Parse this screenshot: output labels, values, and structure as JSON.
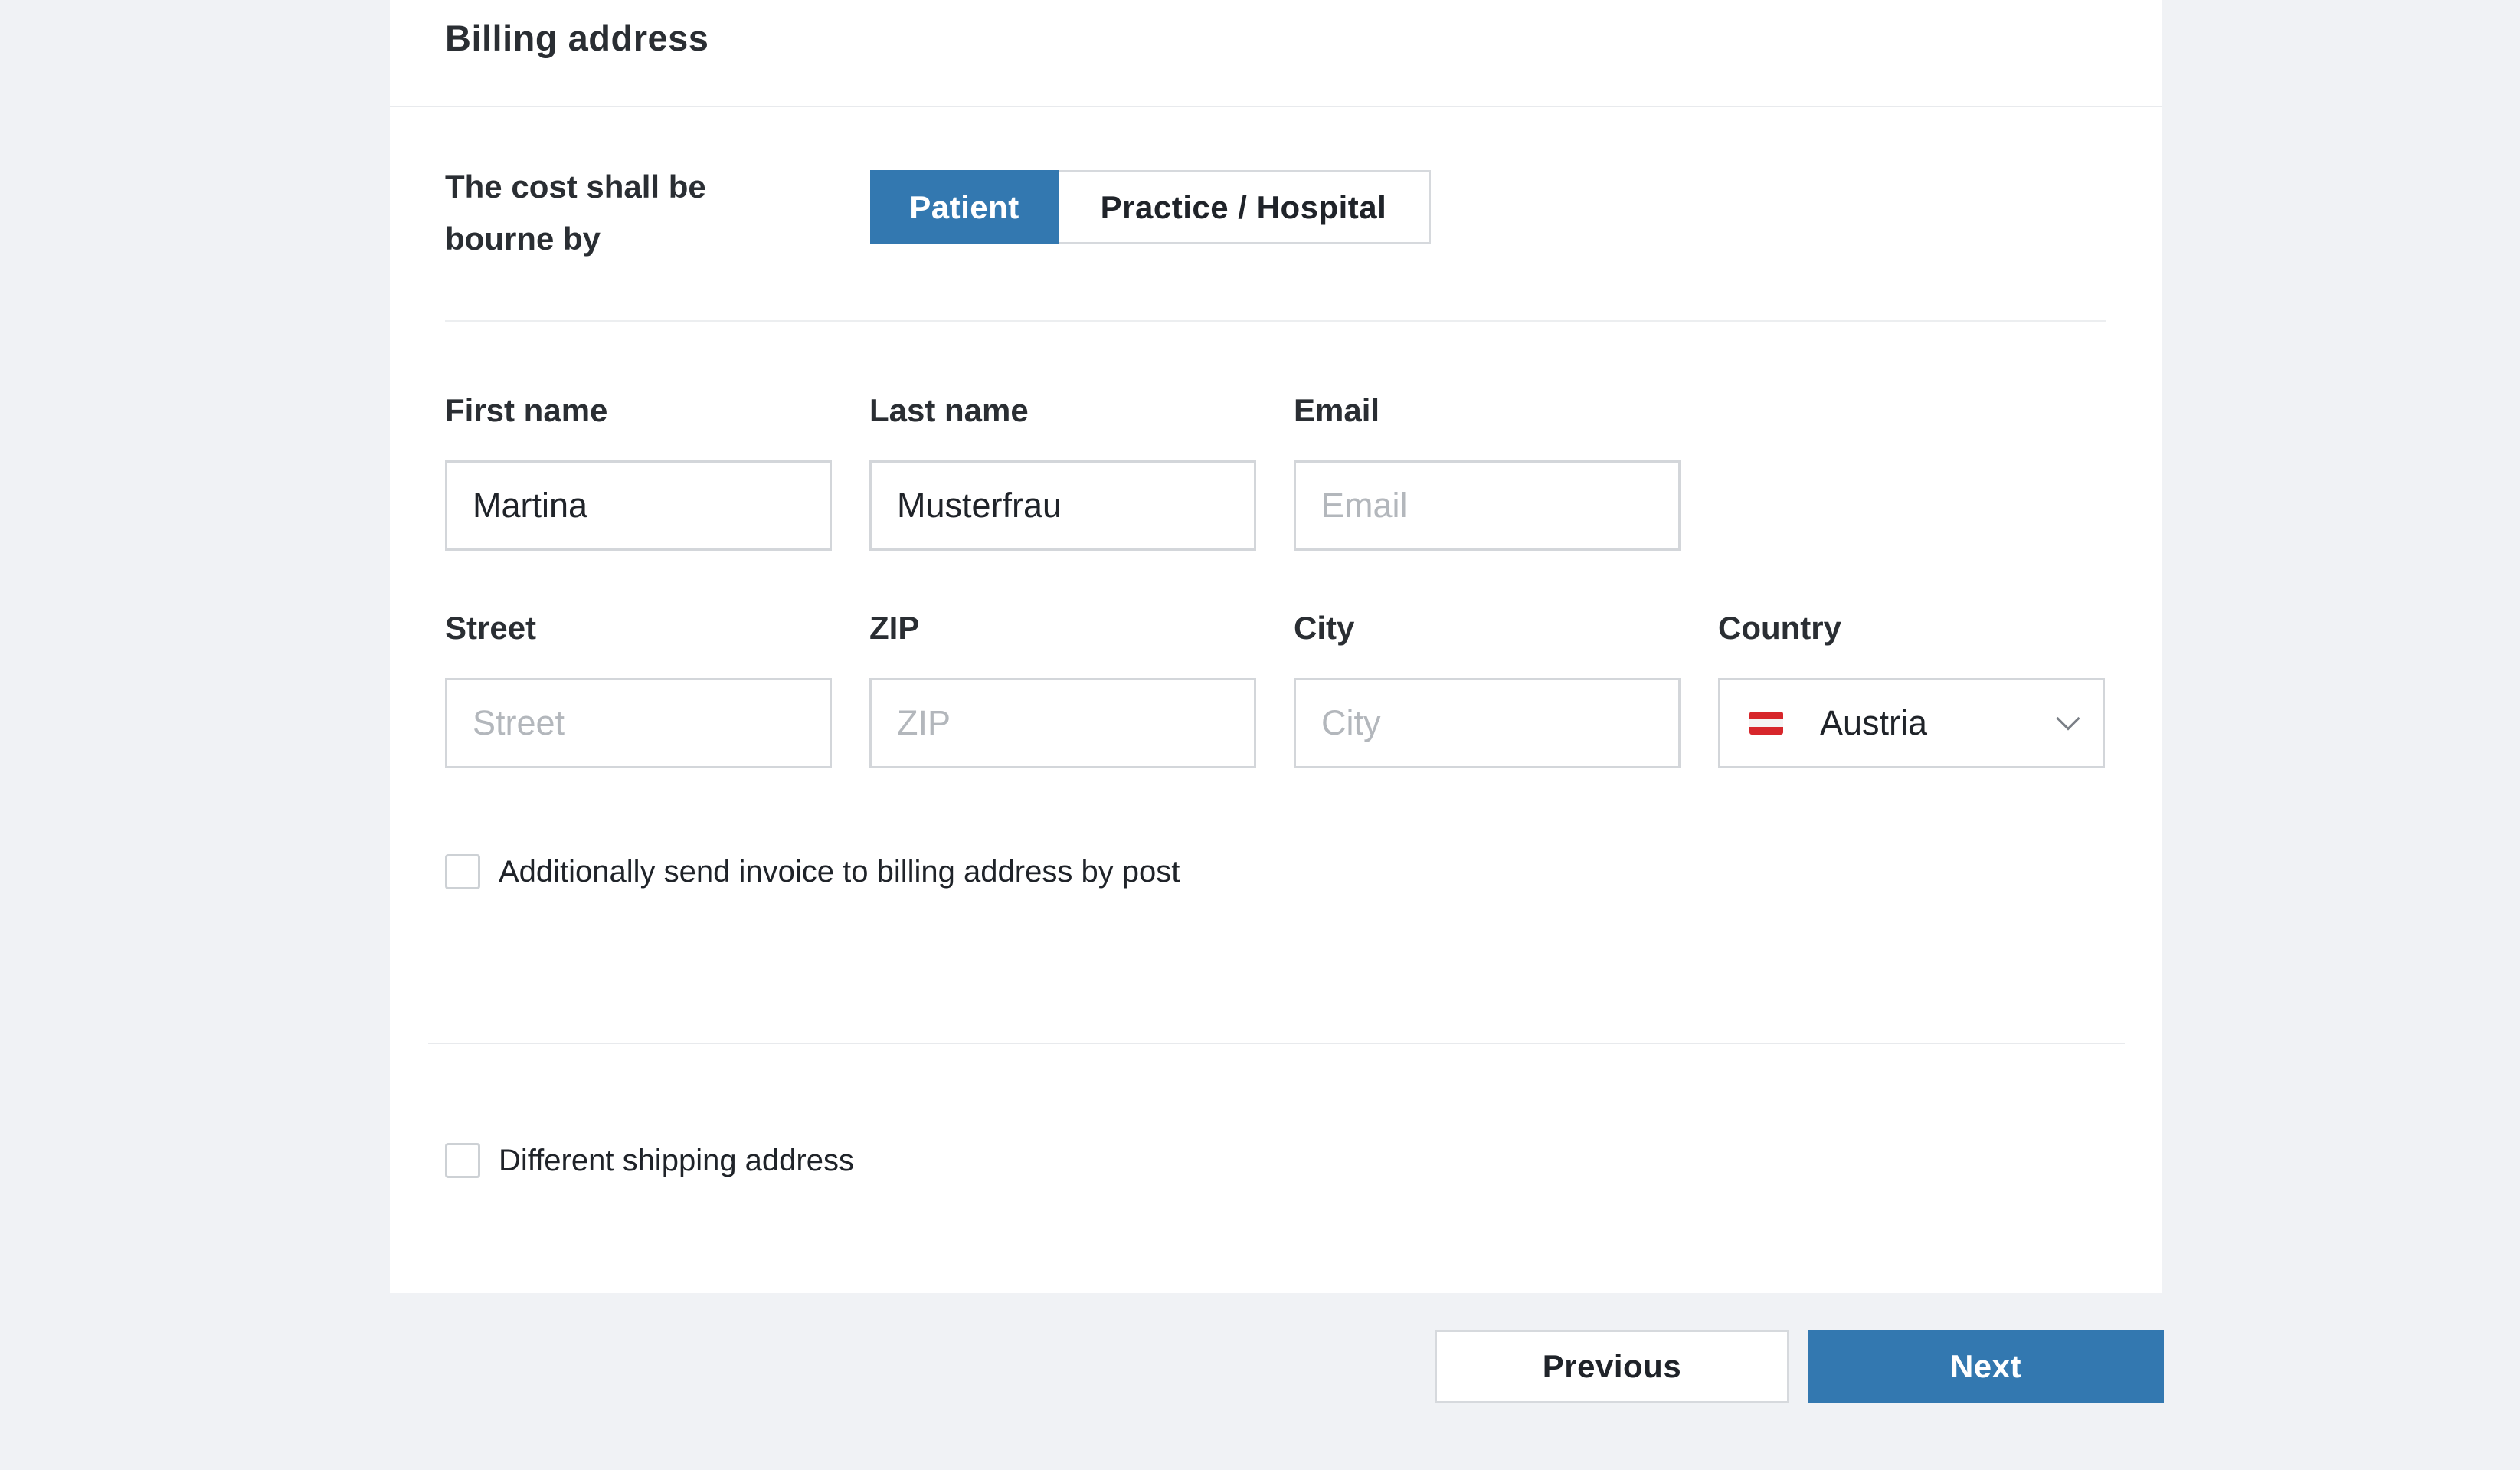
{
  "billing": {
    "title": "Billing address",
    "cost_label": "The cost shall be bourne by",
    "cost_options": {
      "patient": "Patient",
      "practice": "Practice / Hospital"
    },
    "selected_cost_option": "Patient"
  },
  "fields": {
    "first_name": {
      "label": "First name",
      "value": "Martina",
      "placeholder": ""
    },
    "last_name": {
      "label": "Last name",
      "value": "Musterfrau",
      "placeholder": ""
    },
    "email": {
      "label": "Email",
      "value": "",
      "placeholder": "Email"
    },
    "street": {
      "label": "Street",
      "value": "",
      "placeholder": "Street"
    },
    "zip": {
      "label": "ZIP",
      "value": "",
      "placeholder": "ZIP"
    },
    "city": {
      "label": "City",
      "value": "",
      "placeholder": "City"
    },
    "country": {
      "label": "Country",
      "value": "Austria",
      "flag_icon": "austria-flag-icon"
    }
  },
  "checkboxes": {
    "send_by_post": {
      "label": "Additionally send invoice to billing address by post",
      "checked": false
    },
    "different_shipping": {
      "label": "Different shipping address",
      "checked": false
    }
  },
  "nav": {
    "previous": "Previous",
    "next": "Next"
  },
  "colors": {
    "primary": "#3378b0",
    "background": "#f0f2f5",
    "border": "#d3d6da"
  }
}
